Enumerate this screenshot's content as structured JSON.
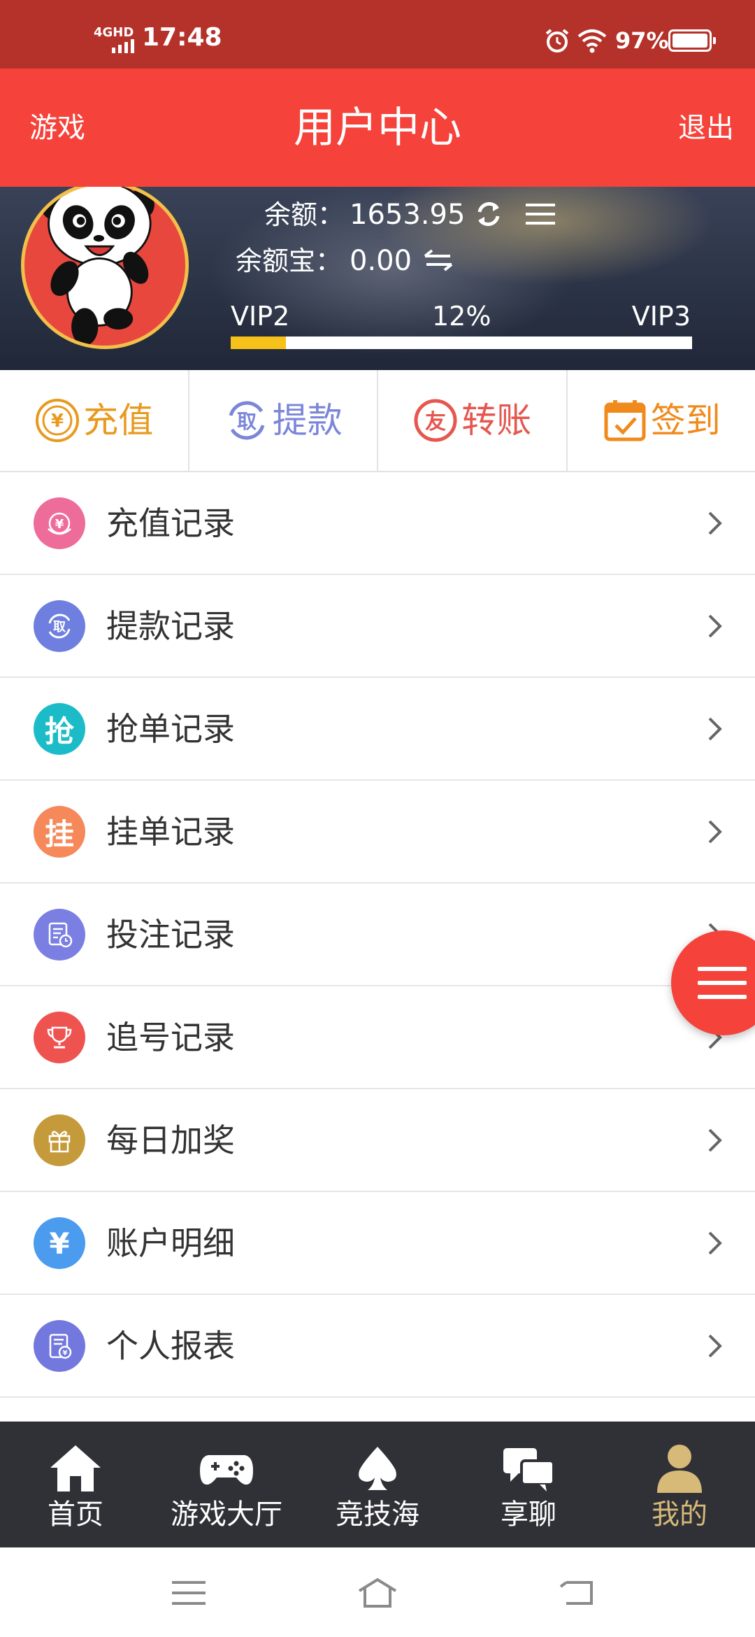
{
  "status_bar": {
    "network": "4GHD",
    "time": "17:48",
    "battery": "97%"
  },
  "header": {
    "left": "游戏",
    "title": "用户中心",
    "right": "退出"
  },
  "account": {
    "balance_label": "余额：",
    "balance": "1653.95",
    "bao_label": "余额宝：",
    "bao": "0.00",
    "vip_current": "VIP2",
    "vip_progress_text": "12%",
    "vip_progress": 0.12,
    "vip_next": "VIP3"
  },
  "quick_actions": [
    {
      "label": "充值",
      "icon": "yen-coin-icon",
      "color": "#e89a1f"
    },
    {
      "label": "提款",
      "icon": "withdraw-icon",
      "color": "#7b86d9"
    },
    {
      "label": "转账",
      "icon": "friend-transfer-icon",
      "color": "#e5574f"
    },
    {
      "label": "签到",
      "icon": "calendar-check-icon",
      "color": "#f08a1c"
    }
  ],
  "menu": [
    {
      "label": "充值记录",
      "icon": "yen-icon",
      "color": "#ee6c9a"
    },
    {
      "label": "提款记录",
      "icon": "withdraw-icon",
      "color": "#6e7fe0"
    },
    {
      "label": "抢单记录",
      "icon_text": "抢",
      "color": "#1bbcc8"
    },
    {
      "label": "挂单记录",
      "icon_text": "挂",
      "color": "#f5895a"
    },
    {
      "label": "投注记录",
      "icon": "document-clock-icon",
      "color": "#7b7fe2"
    },
    {
      "label": "追号记录",
      "icon": "trophy-icon",
      "color": "#ef5350"
    },
    {
      "label": "每日加奖",
      "icon": "gift-icon",
      "color": "#c49a3a"
    },
    {
      "label": "账户明细",
      "icon_text": "¥",
      "color": "#4b9bee"
    },
    {
      "label": "个人报表",
      "icon": "report-icon",
      "color": "#7278de"
    }
  ],
  "tabs": [
    {
      "label": "首页",
      "icon": "home-icon"
    },
    {
      "label": "游戏大厅",
      "icon": "gamepad-icon"
    },
    {
      "label": "竞技海",
      "icon": "spade-icon"
    },
    {
      "label": "享聊",
      "icon": "chat-icon"
    },
    {
      "label": "我的",
      "icon": "user-icon",
      "active": true
    }
  ]
}
